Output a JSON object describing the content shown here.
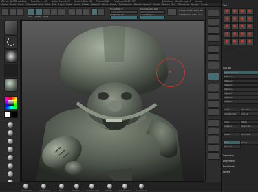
{
  "titlebar": {
    "items": [
      "ZBrush 4R6",
      "ZBrushCore",
      "ScriptBubble  ",
      "Free Mem 1.03",
      "Active Mem 1.78",
      "Scratch Disk 48",
      "Timer 0.018",
      "ATime 0.007",
      "PolyCount 2.474 MP",
      "MeshCount 1"
    ],
    "right": [
      "QuickSave",
      "See-through 0",
      "Menus",
      "DefaultZScript"
    ]
  },
  "menubar": {
    "items": [
      "Alpha",
      "Brush",
      "Color",
      "Document",
      "Draw",
      "Edit",
      "File",
      "Layer",
      "Light",
      "Macro",
      "Marker",
      "Material",
      "Movie",
      "Picker",
      "Preferences",
      "Render",
      "Stencil",
      "Stroke",
      "Texture",
      "Tool",
      "Transform",
      "Zplugin",
      "Zscript"
    ]
  },
  "toolbar": {
    "labels": [
      "Projection Master",
      "LightBox",
      "Quick Sketch",
      "Edit",
      "Draw",
      "Move",
      "Scale",
      "Rotate"
    ],
    "right_labels": [
      "Mrgb",
      "Rgb",
      "M",
      "Zadd",
      "Zsub",
      "Focal Shift 0",
      "Draw Size 64",
      "Rgb Intensity 100",
      "Z Intensity 25",
      "Dynamic",
      "Active Points: 1.227 Mil",
      "Total Points: 1.227 Mil"
    ]
  },
  "viewport": {
    "cursor": "brush-cursor"
  },
  "right_panel": {
    "section_title": "Tool",
    "subtool_title": "SubTool",
    "rows": [
      "Visible Count",
      "Subtool 1",
      "Subtool 2",
      "Subtool 3",
      "Subtool 4",
      "Subtool 5",
      "Subtool 6",
      "Subtool 7"
    ],
    "buttons": [
      "List All",
      "Rename",
      "AutoReorder",
      "All Low",
      "All High",
      "Copy",
      "Paste",
      "Append",
      "Duplicate",
      "Insert",
      "Delete",
      "Del Other",
      "Del All",
      "Split",
      "Merge",
      "Remesh"
    ],
    "dividers": [
      "Geometry",
      "ArrayMesh",
      "NanoMesh",
      "Layers"
    ]
  },
  "bottom": {
    "labels": [
      "SphereInflat",
      "ClayBuildup",
      "Move",
      "Standard",
      "DamStandard",
      "hPolish",
      "TrimDynamic",
      "SnakeHook"
    ]
  }
}
